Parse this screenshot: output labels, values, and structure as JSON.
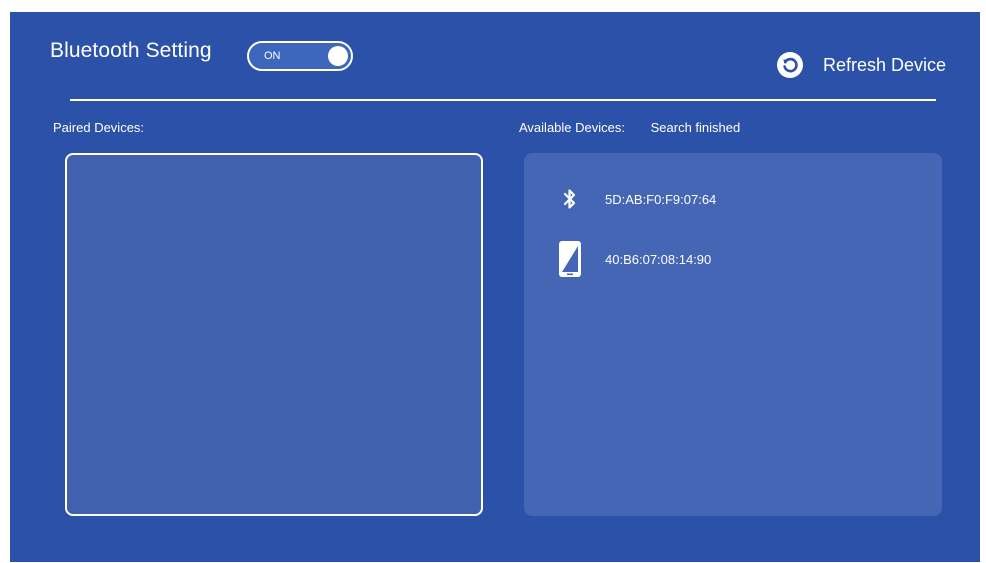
{
  "header": {
    "title": "Bluetooth Setting",
    "toggle": {
      "label": "ON",
      "state": "on"
    },
    "refresh": {
      "label": "Refresh Device",
      "icon": "refresh-icon"
    }
  },
  "paired": {
    "label": "Paired Devices:",
    "devices": []
  },
  "available": {
    "label": "Available Devices:",
    "status": "Search finished",
    "devices": [
      {
        "address": "5D:AB:F0:F9:07:64",
        "icon": "bluetooth-icon"
      },
      {
        "address": "40:B6:07:08:14:90",
        "icon": "phone-icon"
      }
    ]
  },
  "colors": {
    "background": "#2b52a8",
    "panel": "#4466b4",
    "text": "#ffffff"
  }
}
